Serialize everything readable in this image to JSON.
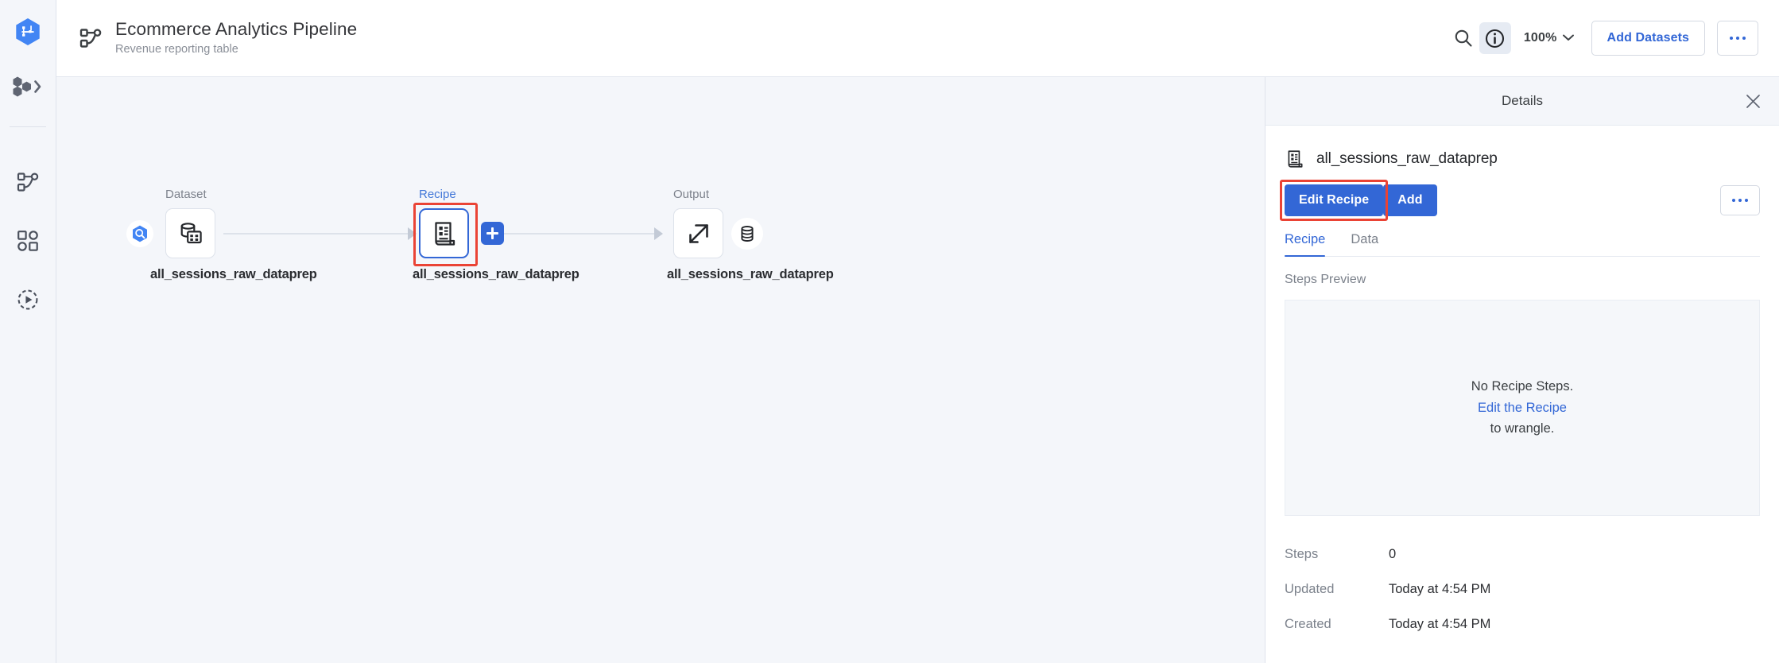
{
  "sidebar": {
    "logo": {
      "name": "dataprep-logo",
      "glyph": "hexagon-logo-icon"
    },
    "flows_switcher": {
      "name": "workspace-switcher",
      "glyph": "hexagons-icon"
    },
    "items": [
      {
        "id": "flows",
        "label": "Flows",
        "icon": "flow-graph-icon"
      },
      {
        "id": "library",
        "label": "Library",
        "icon": "grid-squares-icon"
      },
      {
        "id": "jobs",
        "label": "Job Runs",
        "icon": "play-circle-icon"
      }
    ]
  },
  "header": {
    "icon": "flow-graph-icon",
    "title": "Ecommerce Analytics Pipeline",
    "subtitle": "Revenue reporting table",
    "search_icon": "search-icon",
    "info_icon": "info-circle-icon",
    "zoom_level": "100%",
    "zoom_caret": "chevron-down-icon",
    "add_datasets_label": "Add Datasets",
    "more_icon": "ellipsis-icon"
  },
  "canvas": {
    "nodes": [
      {
        "kind": "Dataset",
        "label": "all_sessions_raw_dataprep",
        "icon": "database-table-icon",
        "badge": "bigquery-icon",
        "selected": false
      },
      {
        "kind": "Recipe",
        "label": "all_sessions_raw_dataprep",
        "icon": "recipe-document-icon",
        "badge": null,
        "selected": true
      },
      {
        "kind": "Output",
        "label": "all_sessions_raw_dataprep",
        "icon": "output-arrow-icon",
        "badge": "database-cylinder-icon",
        "selected": false
      }
    ],
    "add_node_icon": "plus-icon"
  },
  "details": {
    "title": "Details",
    "close_icon": "close-icon",
    "entity_icon": "recipe-document-icon",
    "entity_name": "all_sessions_raw_dataprep",
    "primary_button": "Edit Recipe",
    "secondary_button": "Add",
    "more_icon": "ellipsis-icon",
    "tabs": [
      {
        "label": "Recipe",
        "active": true
      },
      {
        "label": "Data",
        "active": false
      }
    ],
    "steps_preview_label": "Steps Preview",
    "empty_state": {
      "line1": "No Recipe Steps.",
      "link": "Edit the Recipe",
      "line2": "to wrangle."
    },
    "meta": [
      {
        "key": "Steps",
        "value": "0"
      },
      {
        "key": "Updated",
        "value": "Today at 4:54 PM"
      },
      {
        "key": "Created",
        "value": "Today at 4:54 PM"
      }
    ]
  },
  "colors": {
    "accent": "#3367d6",
    "highlight": "#ea4335",
    "canvas_bg": "#f4f6fa",
    "panel_header_bg": "#f4f6fa",
    "text": "#3c4043",
    "muted": "#7b818b"
  }
}
